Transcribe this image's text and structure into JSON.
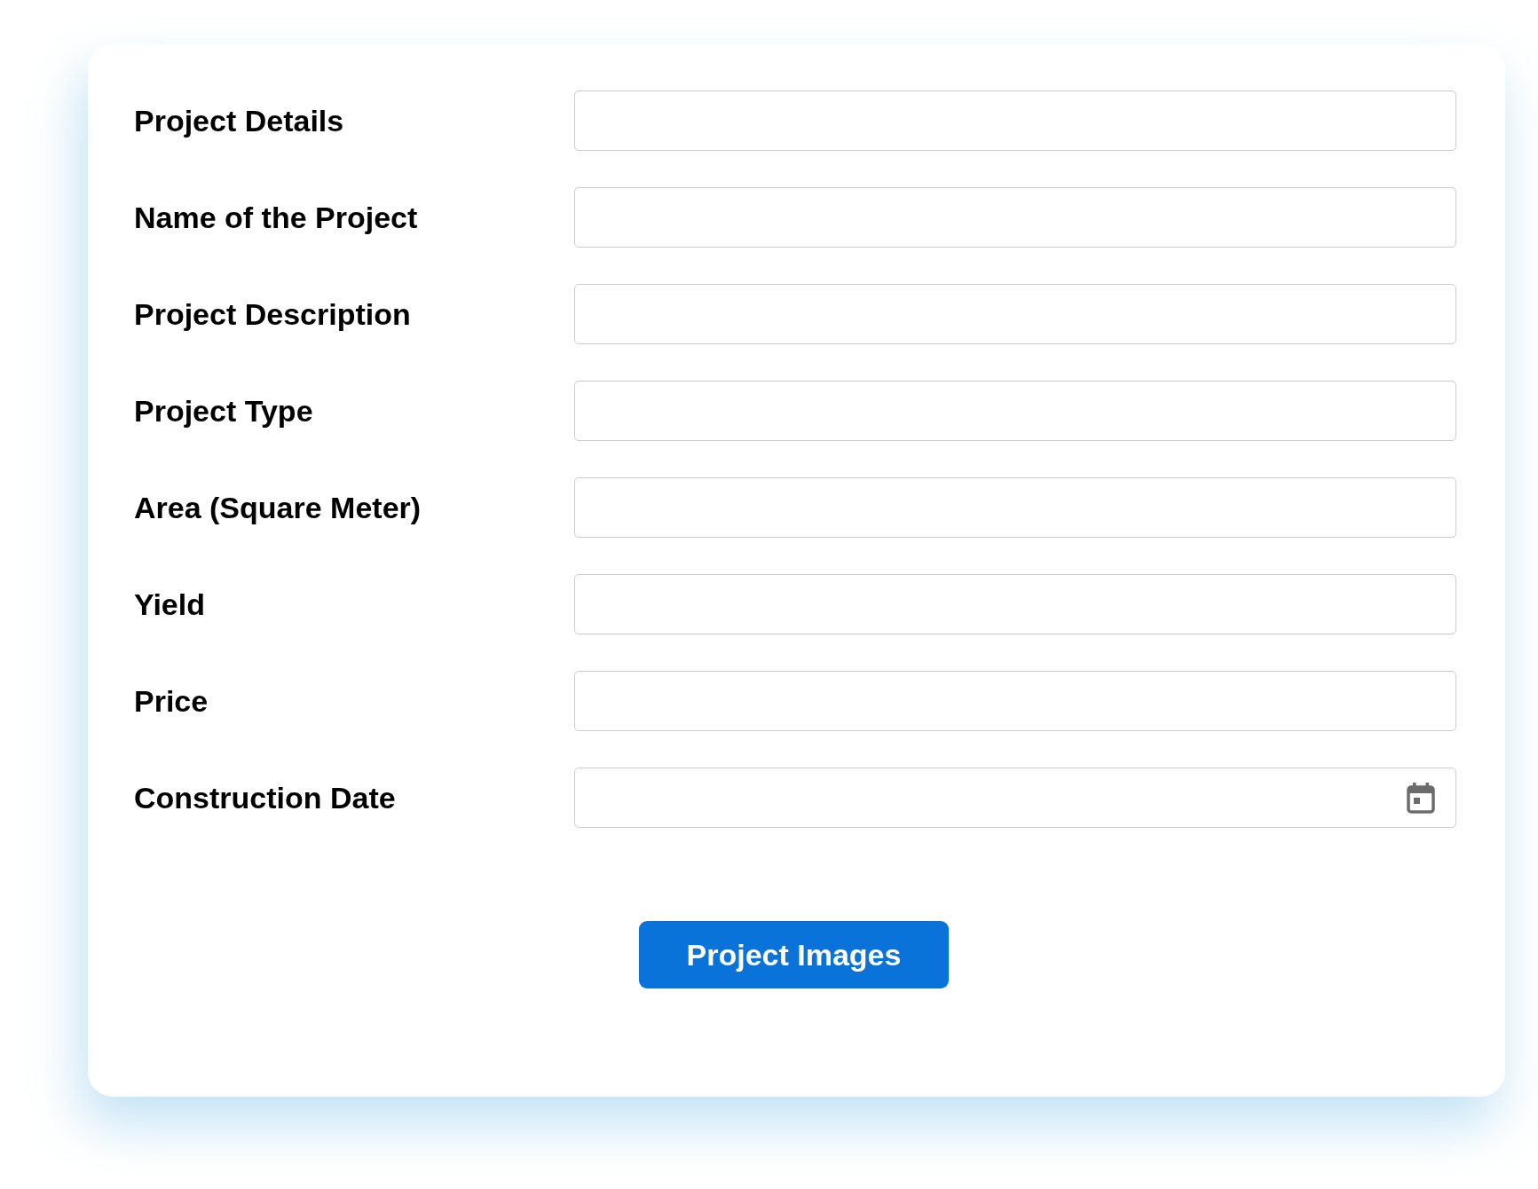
{
  "form": {
    "fields": [
      {
        "label": "Project Details",
        "kind": "text"
      },
      {
        "label": "Name of the Project",
        "kind": "text"
      },
      {
        "label": "Project Description",
        "kind": "text"
      },
      {
        "label": "Project Type",
        "kind": "text"
      },
      {
        "label": "Area (Square Meter)",
        "kind": "text"
      },
      {
        "label": "Yield",
        "kind": "text"
      },
      {
        "label": "Price",
        "kind": "text"
      },
      {
        "label": "Construction Date",
        "kind": "date"
      }
    ],
    "button": "Project Images"
  }
}
